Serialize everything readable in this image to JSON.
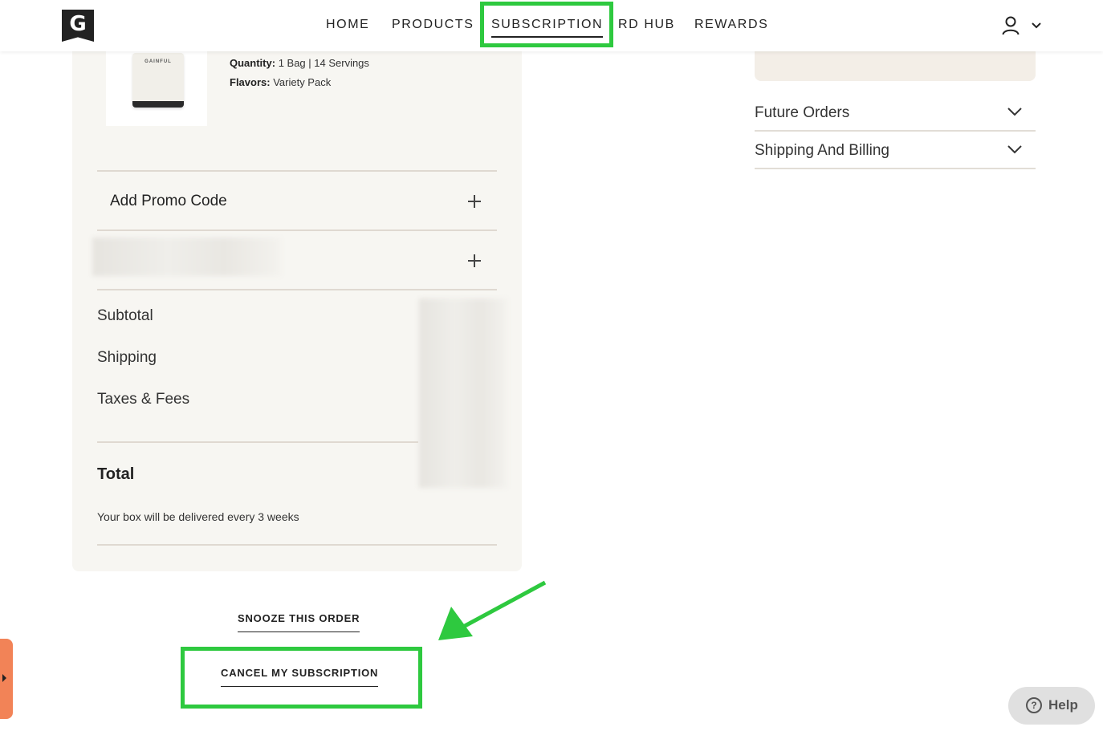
{
  "header": {
    "logo_letter": "G",
    "nav": [
      {
        "label": "HOME"
      },
      {
        "label": "PRODUCTS"
      },
      {
        "label": "SUBSCRIPTION",
        "active": true
      },
      {
        "label": "RD HUB"
      },
      {
        "label": "REWARDS"
      }
    ],
    "account_icon": "user-icon",
    "account_dropdown_icon": "chevron-down-icon"
  },
  "order_summary": {
    "product_image_label": "GAINFUL",
    "quantity_label": "Quantity:",
    "quantity_value": "1 Bag | 14 Servings",
    "flavors_label": "Flavors:",
    "flavors_value": "Variety Pack",
    "promo_label": "Add Promo Code",
    "rows": [
      {
        "label": "Subtotal"
      },
      {
        "label": "Shipping"
      },
      {
        "label": "Taxes & Fees"
      }
    ],
    "total_label": "Total",
    "delivery_note": "Your box will be delivered every 3 weeks"
  },
  "actions": {
    "snooze_label": "SNOOZE THIS ORDER",
    "cancel_label": "CANCEL MY SUBSCRIPTION"
  },
  "right_column": {
    "accordions": [
      {
        "label": "Future Orders"
      },
      {
        "label": "Shipping And Billing"
      }
    ]
  },
  "help": {
    "icon": "?",
    "label": "Help"
  },
  "annotation": {
    "color": "#2ec93f"
  }
}
